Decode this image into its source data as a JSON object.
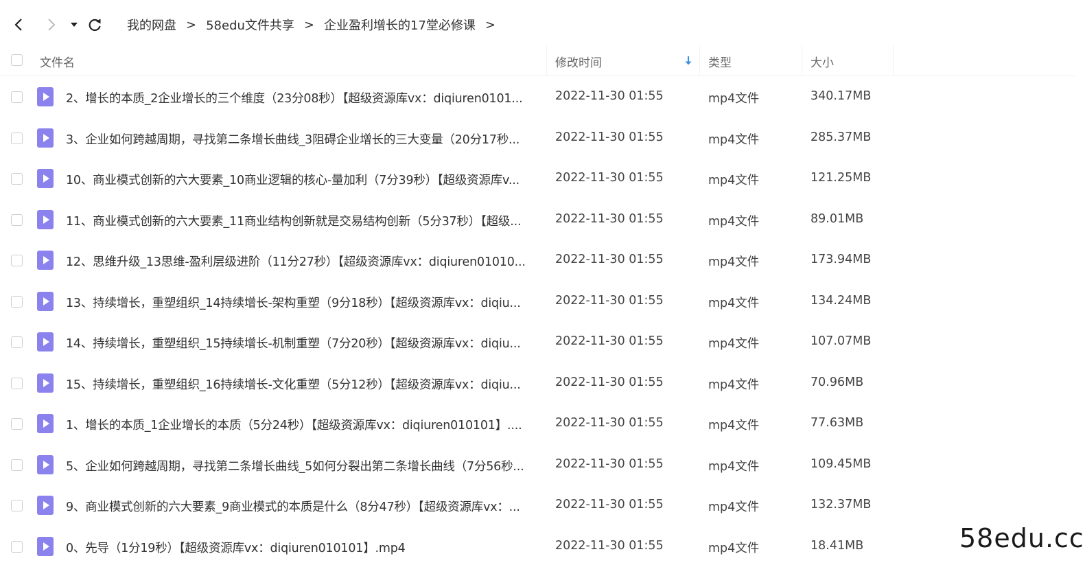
{
  "toolbar": {
    "back_icon": "chevron-left-icon",
    "forward_icon": "chevron-right-icon",
    "dropdown_icon": "caret-down-icon",
    "refresh_icon": "refresh-icon"
  },
  "breadcrumb": {
    "items": [
      "我的网盘",
      "58edu文件共享",
      "企业盈利增长的17堂必修课"
    ],
    "separator": ">"
  },
  "header": {
    "name": "文件名",
    "modified": "修改时间",
    "type": "类型",
    "size": "大小",
    "sort_icon": "arrow-down-icon"
  },
  "colors": {
    "file_icon": "#8b82ee",
    "sort_arrow": "#3a8ee6"
  },
  "files": [
    {
      "name": "2、增长的本质_2企业增长的三个维度（23分08秒）【超级资源库vx：diqiuren0101...",
      "modified": "2022-11-30 01:55",
      "type": "mp4文件",
      "size": "340.17MB"
    },
    {
      "name": "3、企业如何跨越周期，寻找第二条增长曲线_3阻碍企业增长的三大变量（20分17秒...",
      "modified": "2022-11-30 01:55",
      "type": "mp4文件",
      "size": "285.37MB"
    },
    {
      "name": "10、商业模式创新的六大要素_10商业逻辑的核心-量加利（7分39秒）【超级资源库v...",
      "modified": "2022-11-30 01:55",
      "type": "mp4文件",
      "size": "121.25MB"
    },
    {
      "name": "11、商业模式创新的六大要素_11商业结构创新就是交易结构创新（5分37秒）【超级...",
      "modified": "2022-11-30 01:55",
      "type": "mp4文件",
      "size": "89.01MB"
    },
    {
      "name": "12、思维升级_13思维-盈利层级进阶（11分27秒）【超级资源库vx：diqiuren01010...",
      "modified": "2022-11-30 01:55",
      "type": "mp4文件",
      "size": "173.94MB"
    },
    {
      "name": "13、持续增长，重塑组织_14持续增长-架构重塑（9分18秒）【超级资源库vx：diqiu...",
      "modified": "2022-11-30 01:55",
      "type": "mp4文件",
      "size": "134.24MB"
    },
    {
      "name": "14、持续增长，重塑组织_15持续增长-机制重塑（7分20秒）【超级资源库vx：diqiu...",
      "modified": "2022-11-30 01:55",
      "type": "mp4文件",
      "size": "107.07MB"
    },
    {
      "name": "15、持续增长，重塑组织_16持续增长-文化重塑（5分12秒）【超级资源库vx：diqiu...",
      "modified": "2022-11-30 01:55",
      "type": "mp4文件",
      "size": "70.96MB"
    },
    {
      "name": "1、增长的本质_1企业增长的本质（5分24秒）【超级资源库vx：diqiuren010101】....",
      "modified": "2022-11-30 01:55",
      "type": "mp4文件",
      "size": "77.63MB"
    },
    {
      "name": "5、企业如何跨越周期，寻找第二条增长曲线_5如何分裂出第二条增长曲线（7分56秒...",
      "modified": "2022-11-30 01:55",
      "type": "mp4文件",
      "size": "109.45MB"
    },
    {
      "name": "9、商业模式创新的六大要素_9商业模式的本质是什么（8分47秒）【超级资源库vx：...",
      "modified": "2022-11-30 01:55",
      "type": "mp4文件",
      "size": "132.37MB"
    },
    {
      "name": "0、先导（1分19秒）【超级资源库vx：diqiuren010101】.mp4",
      "modified": "2022-11-30 01:55",
      "type": "mp4文件",
      "size": "18.41MB"
    }
  ],
  "watermark": "58edu.cc"
}
